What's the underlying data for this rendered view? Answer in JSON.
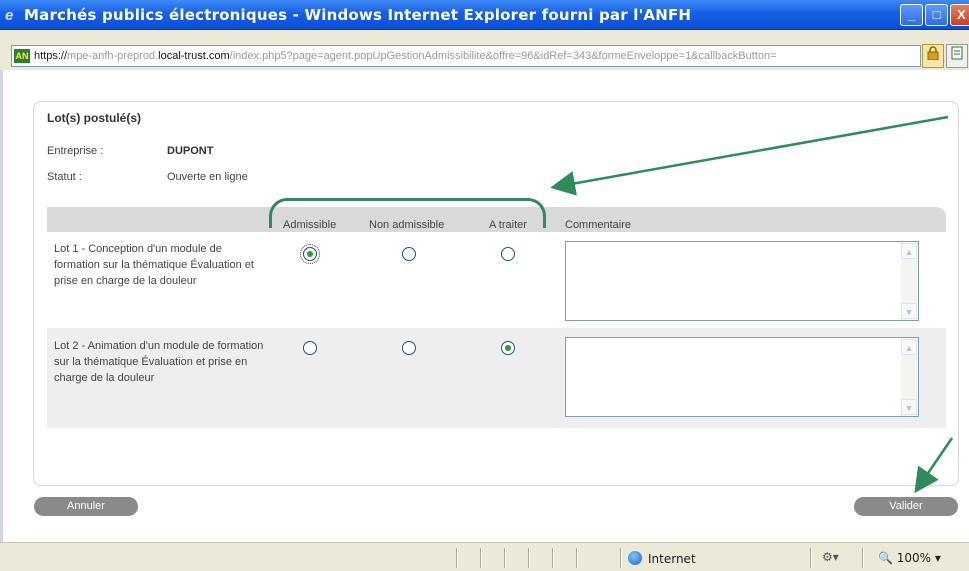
{
  "window": {
    "title": "Marchés publics électroniques - Windows Internet Explorer fourni par l'ANFH",
    "min_label": "_",
    "max_label": "□",
    "close_label": "X"
  },
  "address": {
    "scheme": "https://",
    "subdomain": "mpe-anfh-preprod.",
    "host": "local-trust.com",
    "path": "/index.php5?page=agent.popUpGestionAdmissibilite&offre=96&idRef=343&formeEnveloppe=1&callbackButton=",
    "site_icon": "AN",
    "lock_icon": "lock-icon",
    "page_icon": "page-icon"
  },
  "panel": {
    "title": "Lot(s) postulé(s)",
    "company_label": "Entreprise :",
    "company_value": "DUPONT",
    "status_label": "Statut :",
    "status_value": "Ouverte en ligne"
  },
  "grid": {
    "columns": [
      "Admissible",
      "Non admissible",
      "A traiter",
      "Commentaire"
    ],
    "rows": [
      {
        "lot": "Lot 1 - Conception d'un module de formation sur la thématique Évaluation et prise en charge de la douleur",
        "selected": "Admissible",
        "comment": ""
      },
      {
        "lot": "Lot 2 - Animation d'un module de formation sur la thématique Évaluation et prise en charge de la douleur",
        "selected": "A traiter",
        "comment": ""
      }
    ]
  },
  "actions": {
    "cancel": "Annuler",
    "validate": "Valider"
  },
  "statusbar": {
    "zone": "Internet",
    "zoom": "100%"
  },
  "colors": {
    "annotation": "#2f8a5c",
    "titlebar": "#1760e6",
    "button": "#8a8a8a"
  }
}
